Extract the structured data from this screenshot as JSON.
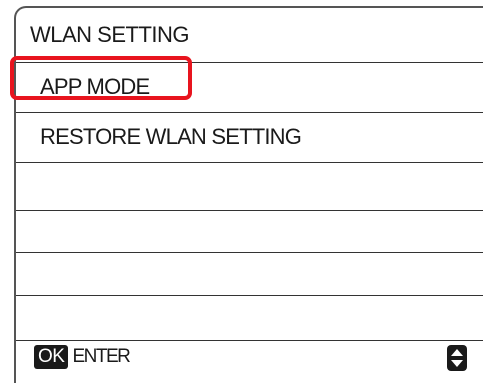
{
  "screen": {
    "title": "WLAN SETTING"
  },
  "menu": {
    "items": [
      {
        "label": "APP MODE",
        "selected": true
      },
      {
        "label": "RESTORE WLAN SETTING",
        "selected": false
      }
    ]
  },
  "footer": {
    "ok_badge": "OK",
    "ok_action": "ENTER",
    "nav_icon": "up-down-arrows-icon"
  },
  "colors": {
    "highlight": "#e8141e",
    "text": "#1a1a1a"
  }
}
